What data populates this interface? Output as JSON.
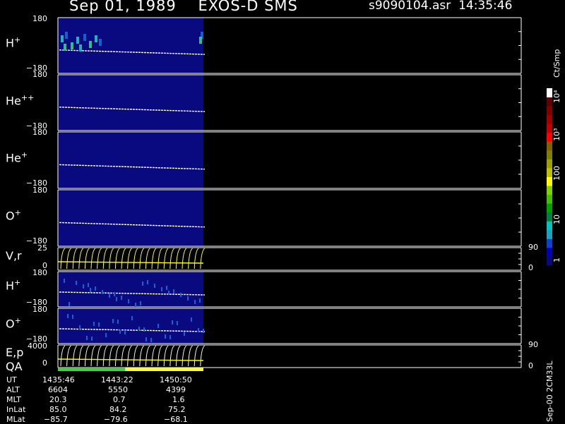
{
  "header": {
    "title": "Sep 01, 1989    EXOS-D SMS",
    "file": "s9090104.asr",
    "time": "14:35:46"
  },
  "panels": [
    {
      "label_main": "H",
      "label_sup": "+",
      "ymax": "180",
      "ymin": "−180"
    },
    {
      "label_main": "He",
      "label_sup": "++",
      "ymax": "180",
      "ymin": "−180"
    },
    {
      "label_main": "He",
      "label_sup": "+",
      "ymax": "180",
      "ymin": "−180"
    },
    {
      "label_main": "O",
      "label_sup": "+",
      "ymax": "180",
      "ymin": "−180"
    },
    {
      "label_main": "V,r",
      "label_sup": "",
      "ymax": "25",
      "ymin": "0",
      "rmax": "90",
      "rmin": "0"
    },
    {
      "label_main": "H",
      "label_sup": "+",
      "ymax": "180",
      "ymin": "−180"
    },
    {
      "label_main": "O",
      "label_sup": "+",
      "ymax": "180",
      "ymin": "−180"
    },
    {
      "label_main": "E,p",
      "label_sup": "",
      "ymax": "4000",
      "ymin": "0",
      "rmax": "90",
      "rmin": "0"
    }
  ],
  "qa_label": "QA",
  "colorbar": {
    "unit": "Ct/Smp",
    "ticks": [
      "1",
      "10",
      "100",
      "10³",
      "10⁴"
    ],
    "colors": [
      "#0a0a7a",
      "#0000b4",
      "#1040d0",
      "#20a0c0",
      "#00c0c0",
      "#008040",
      "#00a000",
      "#40c000",
      "#80d000",
      "#ffff00",
      "#c0c000",
      "#a0a000",
      "#808000",
      "#806000",
      "#ff0000",
      "#c00000",
      "#a00000",
      "#800000",
      "#600000",
      "#ffffff"
    ]
  },
  "side_note": "Sep-00  2CM33L",
  "orbit": {
    "labels": [
      "UT",
      "ALT",
      "MLT",
      "InLat",
      "MLat"
    ],
    "columns": [
      [
        "1435:46",
        "6604",
        "20.3",
        "85.0",
        "−85.7"
      ],
      [
        "1443:22",
        "5550",
        "0.7",
        "84.2",
        "−79.6"
      ],
      [
        "1450:50",
        "4399",
        "1.6",
        "75.2",
        "−68.1"
      ]
    ]
  },
  "chart_data": {
    "type": "heatmap",
    "title": "Sep 01, 1989    EXOS-D SMS",
    "time_ticks": [
      "1435:46",
      "1443:22",
      "1450:50"
    ],
    "panels": [
      "H+",
      "He++",
      "He+",
      "O+",
      "V,r",
      "H+",
      "O+",
      "E,p"
    ],
    "data_extent_fraction": 0.317,
    "color_scale": "log",
    "color_range": [
      1,
      10000
    ]
  }
}
